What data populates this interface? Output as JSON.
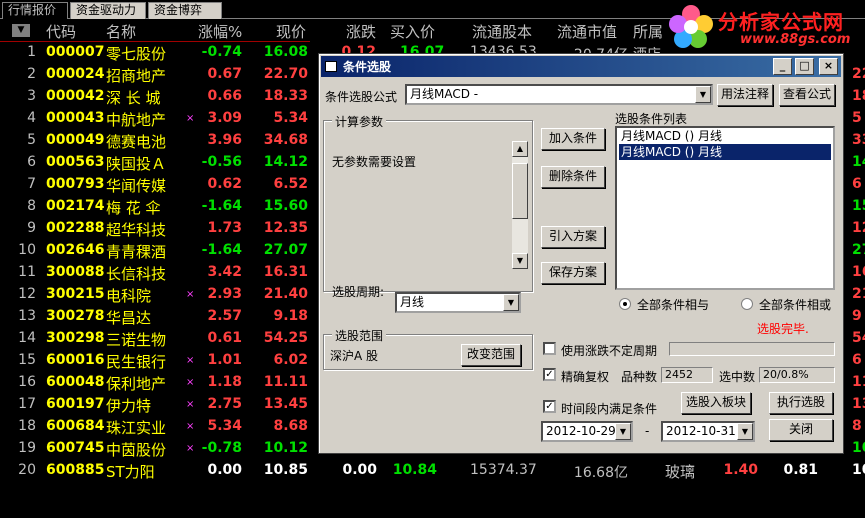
{
  "tabs": [
    "行情报价",
    "资金驱动力",
    "资金博弈"
  ],
  "logo": {
    "title": "分析家公式网",
    "url": "www.88gs.com"
  },
  "header": {
    "code": "代码",
    "name": "名称",
    "pct": "涨幅%",
    "price": "现价",
    "chg": "涨跌",
    "buy": "买入价",
    "float_shares": "流通股本",
    "float_mcap": "流通市值",
    "industry": "所属"
  },
  "rows": [
    {
      "idx": "1",
      "code": "000007",
      "name": "零七股份",
      "mark": "",
      "pct": "-0.74",
      "price": "16.08",
      "dir": "down",
      "edge": ""
    },
    {
      "idx": "2",
      "code": "000024",
      "name": "招商地产",
      "mark": "",
      "pct": "0.67",
      "price": "22.70",
      "dir": "up",
      "edge": "22"
    },
    {
      "idx": "3",
      "code": "000042",
      "name": "深 长 城",
      "mark": "",
      "pct": "0.66",
      "price": "18.33",
      "dir": "up",
      "edge": "18"
    },
    {
      "idx": "4",
      "code": "000043",
      "name": "中航地产",
      "mark": "×",
      "pct": "3.09",
      "price": "5.34",
      "dir": "up",
      "edge": "5"
    },
    {
      "idx": "5",
      "code": "000049",
      "name": "德赛电池",
      "mark": "",
      "pct": "3.96",
      "price": "34.68",
      "dir": "up",
      "edge": "33"
    },
    {
      "idx": "6",
      "code": "000563",
      "name": "陕国投Ａ",
      "mark": "",
      "pct": "-0.56",
      "price": "14.12",
      "dir": "down",
      "edge": "14"
    },
    {
      "idx": "7",
      "code": "000793",
      "name": "华闻传媒",
      "mark": "",
      "pct": "0.62",
      "price": "6.52",
      "dir": "up",
      "edge": "6"
    },
    {
      "idx": "8",
      "code": "002174",
      "name": "梅 花 伞",
      "mark": "",
      "pct": "-1.64",
      "price": "15.60",
      "dir": "down",
      "edge": "15"
    },
    {
      "idx": "9",
      "code": "002288",
      "name": "超华科技",
      "mark": "",
      "pct": "1.73",
      "price": "12.35",
      "dir": "up",
      "edge": "12"
    },
    {
      "idx": "10",
      "code": "002646",
      "name": "青青稞酒",
      "mark": "",
      "pct": "-1.64",
      "price": "27.07",
      "dir": "down",
      "edge": "27"
    },
    {
      "idx": "11",
      "code": "300088",
      "name": "长信科技",
      "mark": "",
      "pct": "3.42",
      "price": "16.31",
      "dir": "up",
      "edge": "16"
    },
    {
      "idx": "12",
      "code": "300215",
      "name": "电科院",
      "mark": "×",
      "pct": "2.93",
      "price": "21.40",
      "dir": "up",
      "edge": "21"
    },
    {
      "idx": "13",
      "code": "300278",
      "name": "华昌达",
      "mark": "",
      "pct": "2.57",
      "price": "9.18",
      "dir": "up",
      "edge": "9"
    },
    {
      "idx": "14",
      "code": "300298",
      "name": "三诺生物",
      "mark": "",
      "pct": "0.61",
      "price": "54.25",
      "dir": "up",
      "edge": "54"
    },
    {
      "idx": "15",
      "code": "600016",
      "name": "民生银行",
      "mark": "×",
      "pct": "1.01",
      "price": "6.02",
      "dir": "up",
      "edge": "6"
    },
    {
      "idx": "16",
      "code": "600048",
      "name": "保利地产",
      "mark": "×",
      "pct": "1.18",
      "price": "11.11",
      "dir": "up",
      "edge": "11"
    },
    {
      "idx": "17",
      "code": "600197",
      "name": "伊力特",
      "mark": "×",
      "pct": "2.75",
      "price": "13.45",
      "dir": "up",
      "edge": "13"
    },
    {
      "idx": "18",
      "code": "600684",
      "name": "珠江实业",
      "mark": "×",
      "pct": "5.34",
      "price": "8.68",
      "dir": "up",
      "edge": "8"
    },
    {
      "idx": "19",
      "code": "600745",
      "name": "中茵股份",
      "mark": "×",
      "pct": "-0.78",
      "price": "10.12",
      "dir": "down",
      "edge": "10"
    }
  ],
  "last_row": {
    "idx": "20",
    "code": "600885",
    "name": "ST力阳",
    "pct": "0.00",
    "price": "10.85",
    "chg": "0.00",
    "buy": "10.84",
    "float_shares": "15374.37",
    "float_mcap": "16.68亿",
    "industry": "玻璃",
    "x1": "1.40",
    "x2": "0.81",
    "edge": "10"
  },
  "row1_overflow": {
    "chg": "0.12",
    "buy": "16.07",
    "float_shares": "13436.53",
    "float_mcap": "20.74亿",
    "industry": "酒店"
  },
  "dialog": {
    "title": "条件选股",
    "formula_label": "条件选股公式",
    "formula_value": "月线MACD -",
    "usage_btn": "用法注释",
    "view_formula_btn": "查看公式",
    "param_group": "计算参数",
    "param_text": "无参数需要设置",
    "period_label": "选股周期:",
    "period_value": "月线",
    "add_btn": "加入条件",
    "delete_btn": "删除条件",
    "import_btn": "引入方案",
    "save_btn": "保存方案",
    "list_label": "选股条件列表",
    "list_items": [
      "月线MACD () 月线",
      "月线MACD () 月线"
    ],
    "radio_and": "全部条件相与",
    "radio_or": "全部条件相或",
    "done_text": "选股完毕.",
    "range_group": "选股范围",
    "range_value": "深沪A 股",
    "change_range_btn": "改变范围",
    "chk_period": "使用涨跌不定周期",
    "chk_adjust": "精确复权",
    "variety_label": "品种数",
    "variety_value": "2452",
    "selected_label": "选中数",
    "selected_value": "20/0.8%",
    "chk_time": "时间段内满足条件",
    "to_block_btn": "选股入板块",
    "run_btn": "执行选股",
    "date_from": "2012-10-29",
    "dash": "-",
    "date_to": "2012-10-31",
    "close_btn": "关闭"
  },
  "colors": {
    "up": "#ff4040",
    "down": "#00e000",
    "code": "#ffff00",
    "title_bar": "#0a246a",
    "done": "#ff0000"
  }
}
